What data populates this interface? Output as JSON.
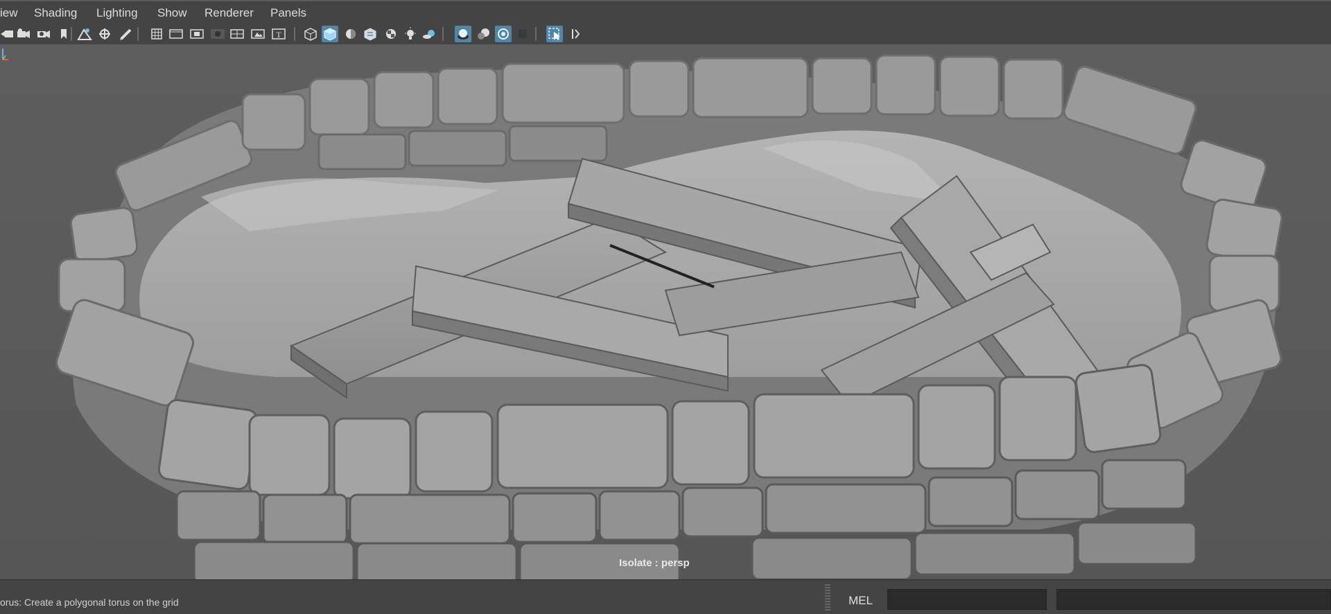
{
  "menubar": {
    "items": [
      "iew",
      "Shading",
      "Lighting",
      "Show",
      "Renderer",
      "Panels"
    ]
  },
  "toolbar": {
    "icons": [
      "camera-select-icon",
      "camera-attributes-icon",
      "bookmark-icon",
      "image-plane-icon",
      "two-d-pan-zoom-icon",
      "grease-pencil-icon",
      "grid-icon",
      "film-gate-icon",
      "resolution-gate-icon",
      "gate-mask-icon",
      "field-chart-icon",
      "safe-action-icon",
      "safe-title-icon",
      "wireframe-icon",
      "smooth-shade-all-icon",
      "default-material-icon",
      "textured-icon",
      "xray-checker-icon",
      "use-all-lights-icon",
      "shadows-icon",
      "screen-space-ao-icon",
      "motion-blur-icon",
      "anti-aliasing-icon",
      "depth-of-field-icon",
      "isolate-select-icon",
      "xray-icon"
    ]
  },
  "viewport": {
    "isolate_label": "Isolate : persp",
    "axis_labels": {
      "y": "y",
      "z": "z"
    }
  },
  "statusbar": {
    "help_text": "orus: Create a polygonal torus on the grid",
    "mel_label": "MEL"
  },
  "colors": {
    "background": "#444444",
    "viewport": "#5c5c5c",
    "active_icon": "#5285a6",
    "field": "#2b2b2b"
  }
}
